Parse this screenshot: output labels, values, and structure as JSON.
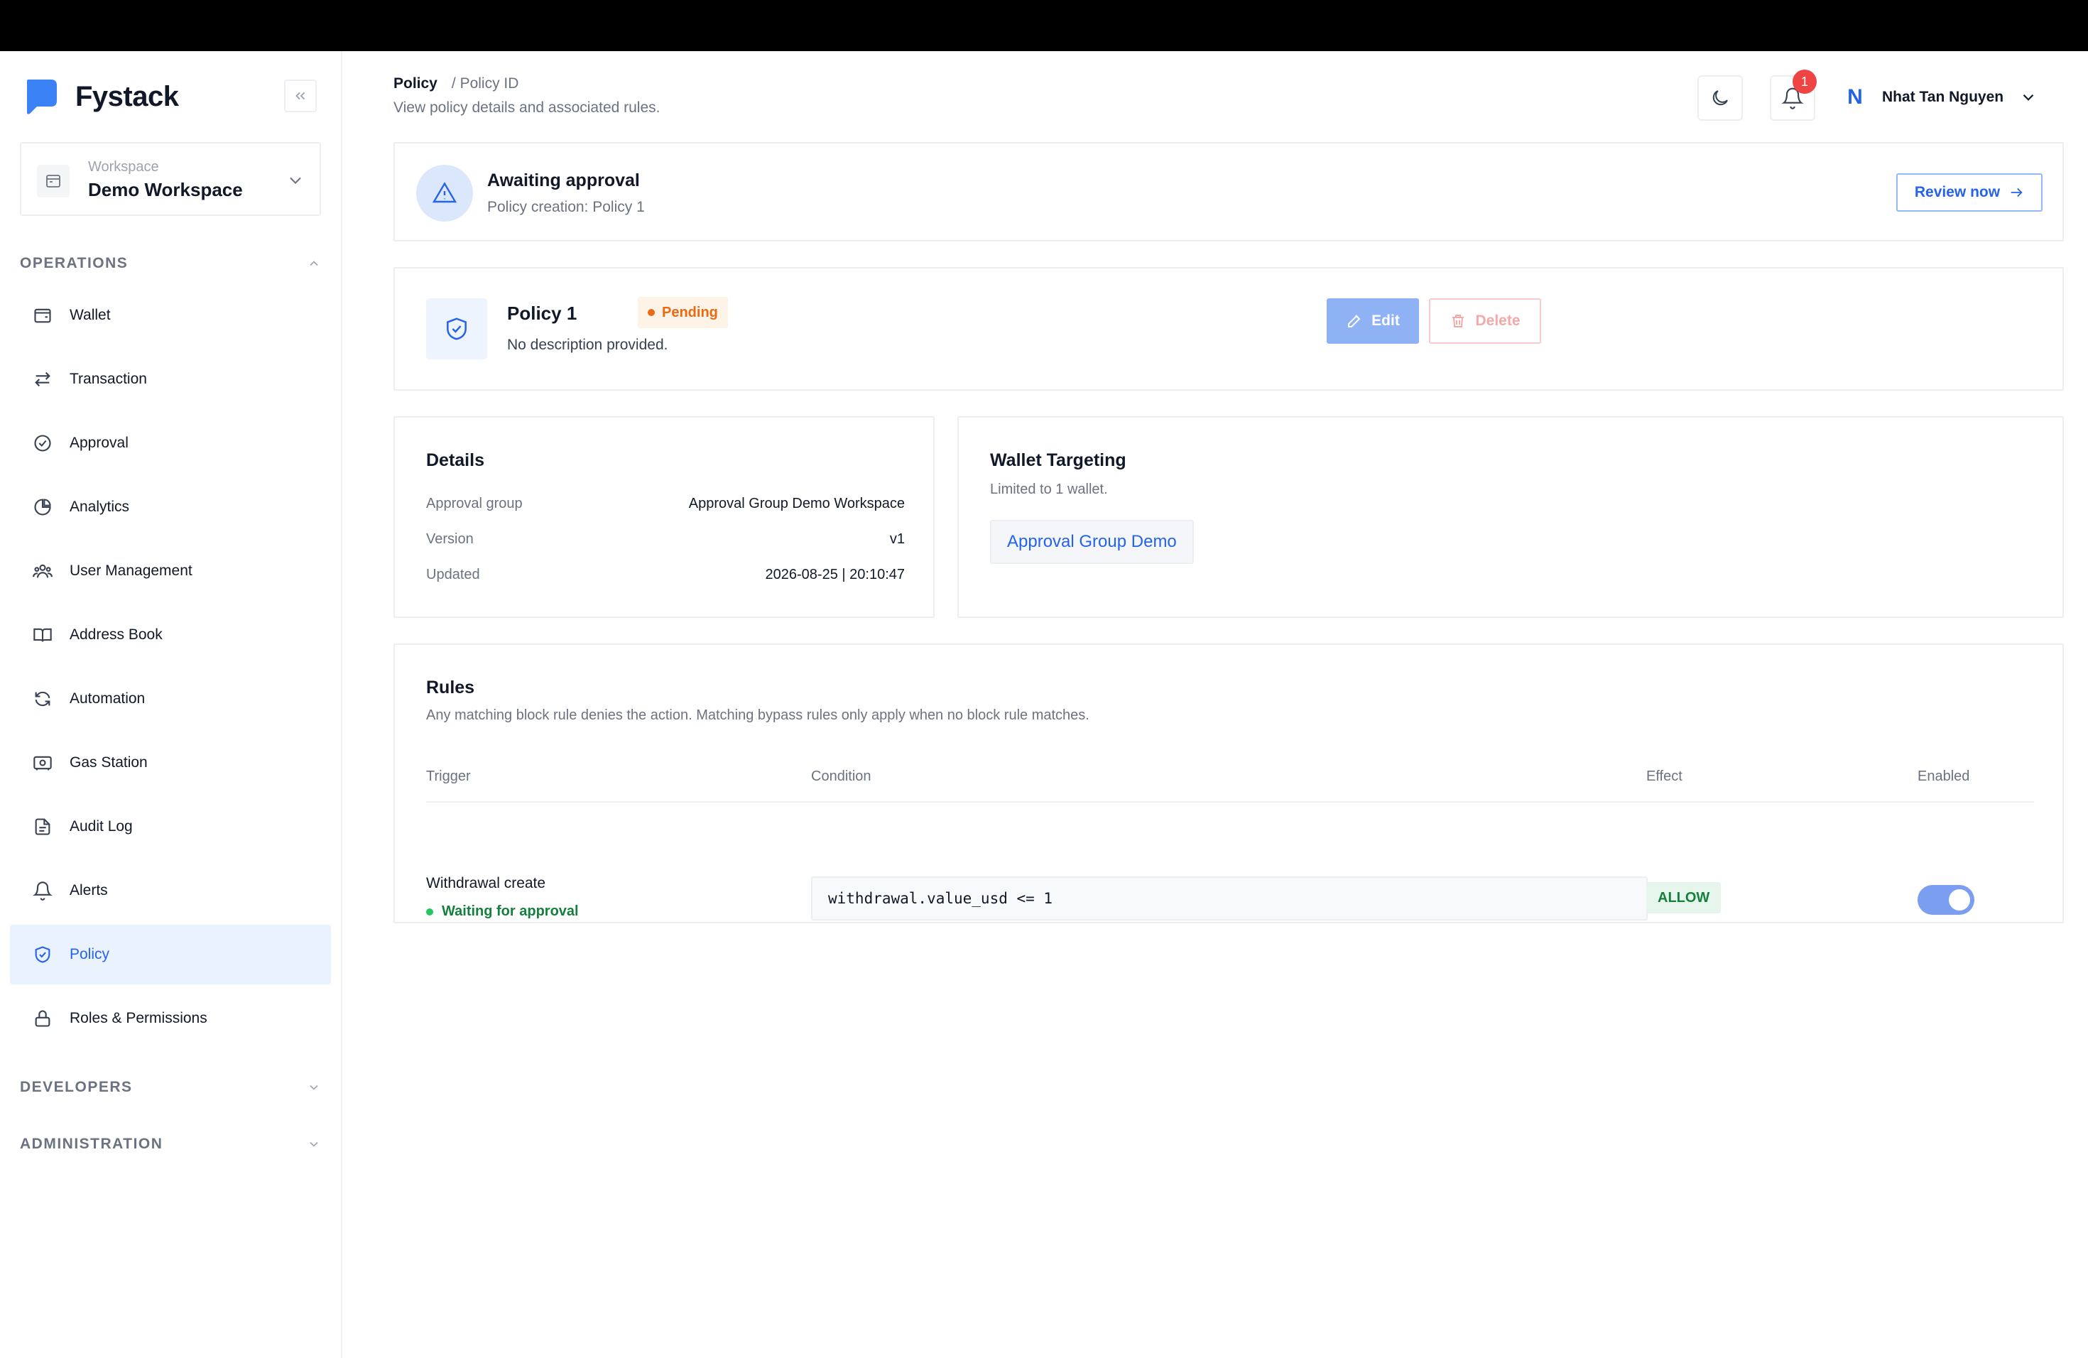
{
  "sidebar": {
    "brand": "Fystack",
    "workspace": {
      "label": "Workspace",
      "name": "Demo Workspace"
    },
    "sections": {
      "operations": "OPERATIONS",
      "developers": "DEVELOPERS",
      "administration": "ADMINISTRATION"
    },
    "items": [
      {
        "label": "Wallet",
        "icon": "wallet-icon"
      },
      {
        "label": "Transaction",
        "icon": "transfer-icon"
      },
      {
        "label": "Approval",
        "icon": "check-circle-icon"
      },
      {
        "label": "Analytics",
        "icon": "pie-chart-icon"
      },
      {
        "label": "User Management",
        "icon": "users-icon"
      },
      {
        "label": "Address Book",
        "icon": "book-icon"
      },
      {
        "label": "Automation",
        "icon": "refresh-icon"
      },
      {
        "label": "Gas Station",
        "icon": "gas-station-icon"
      },
      {
        "label": "Audit Log",
        "icon": "file-icon"
      },
      {
        "label": "Alerts",
        "icon": "bell-icon"
      },
      {
        "label": "Policy",
        "icon": "shield-check-icon"
      },
      {
        "label": "Roles & Permissions",
        "icon": "lock-icon"
      }
    ],
    "active_item": "Policy"
  },
  "header": {
    "breadcrumb": {
      "current": "Policy",
      "separator": "/",
      "page": "Policy ID"
    },
    "subtitle": "View policy details and associated rules.",
    "notification_count": "1",
    "user": {
      "initial": "N",
      "name": "Nhat Tan Nguyen"
    }
  },
  "approval_banner": {
    "title": "Awaiting approval",
    "subtitle": "Policy creation: Policy 1",
    "action_label": "Review now"
  },
  "policy": {
    "name": "Policy 1",
    "status": "Pending",
    "description": "No description provided.",
    "edit_label": "Edit",
    "delete_label": "Delete"
  },
  "details": {
    "title": "Details",
    "rows": [
      {
        "key": "Approval group",
        "value": "Approval Group Demo Workspace"
      },
      {
        "key": "Version",
        "value": "v1"
      },
      {
        "key": "Updated",
        "value": "2026-08-25 | 20:10:47"
      }
    ]
  },
  "wallet_targeting": {
    "title": "Wallet Targeting",
    "subtitle": "Limited to 1 wallet.",
    "wallet": "Approval Group Demo"
  },
  "rules": {
    "title": "Rules",
    "subtitle": "Any matching block rule denies the action. Matching bypass rules only apply when no block rule matches.",
    "columns": [
      "Trigger",
      "Condition",
      "Effect",
      "Enabled"
    ],
    "rows": [
      {
        "trigger": "Withdrawal create",
        "status": "Waiting for approval",
        "condition": "withdrawal.value_usd <= 1",
        "effect": "ALLOW",
        "enabled": true
      }
    ]
  },
  "colors": {
    "accent": "#2563eb",
    "active_bg": "#eaf2fe",
    "pending": "#ea6a12",
    "success": "#15803d",
    "danger": "#ef4444"
  }
}
